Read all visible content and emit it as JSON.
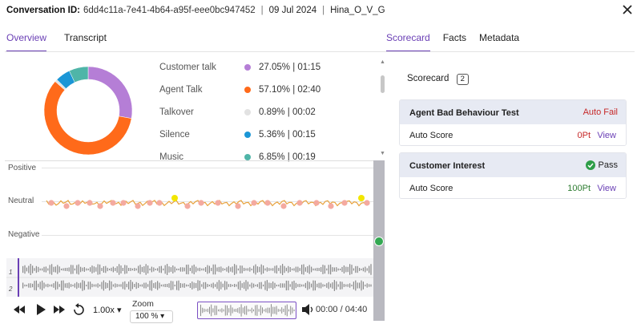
{
  "header": {
    "conversation_label": "Conversation ID:",
    "conversation_id": "6dd4c11a-7e41-4b64-a95f-eee0bc947452",
    "date": "09 Jul 2024",
    "agent": "Hina_O_V_G"
  },
  "left_tabs": [
    {
      "label": "Overview",
      "active": true
    },
    {
      "label": "Transcript",
      "active": false
    }
  ],
  "right_tabs": [
    {
      "label": "Scorecard",
      "active": true
    },
    {
      "label": "Facts",
      "active": false
    },
    {
      "label": "Metadata",
      "active": false
    }
  ],
  "talk_stats": [
    {
      "name": "Customer talk",
      "percent": 27.05,
      "display": "27.05% | 01:15",
      "color": "#b57ed6"
    },
    {
      "name": "Agent Talk",
      "percent": 57.1,
      "display": "57.10% | 02:40",
      "color": "#ff6a1a"
    },
    {
      "name": "Talkover",
      "percent": 0.89,
      "display": "0.89% | 00:02",
      "color": "#e2e2e2"
    },
    {
      "name": "Silence",
      "percent": 5.36,
      "display": "5.36% | 00:15",
      "color": "#1b96d6"
    },
    {
      "name": "Music",
      "percent": 6.85,
      "display": "6.85% | 00:19",
      "color": "#4fb5a8"
    }
  ],
  "sentiment": {
    "positive_label": "Positive",
    "neutral_label": "Neutral",
    "negative_label": "Negative"
  },
  "tracks": [
    "1",
    "2"
  ],
  "player": {
    "speed": "1.00x",
    "zoom_label": "Zoom",
    "zoom_value": "100 %",
    "time": "00:00 / 04:40"
  },
  "scorecard": {
    "title": "Scorecard",
    "count": "2",
    "cards": [
      {
        "title": "Agent Bad Behaviour Test",
        "status": "Auto Fail",
        "status_color": "#c62828",
        "score_label": "Auto Score",
        "points": "0Pt",
        "points_color": "#c62828",
        "view": "View"
      },
      {
        "title": "Customer Interest",
        "status": "Pass",
        "status_color": "#222222",
        "score_label": "Auto Score",
        "points": "100Pt",
        "points_color": "#2e7d32",
        "view": "View"
      }
    ]
  }
}
